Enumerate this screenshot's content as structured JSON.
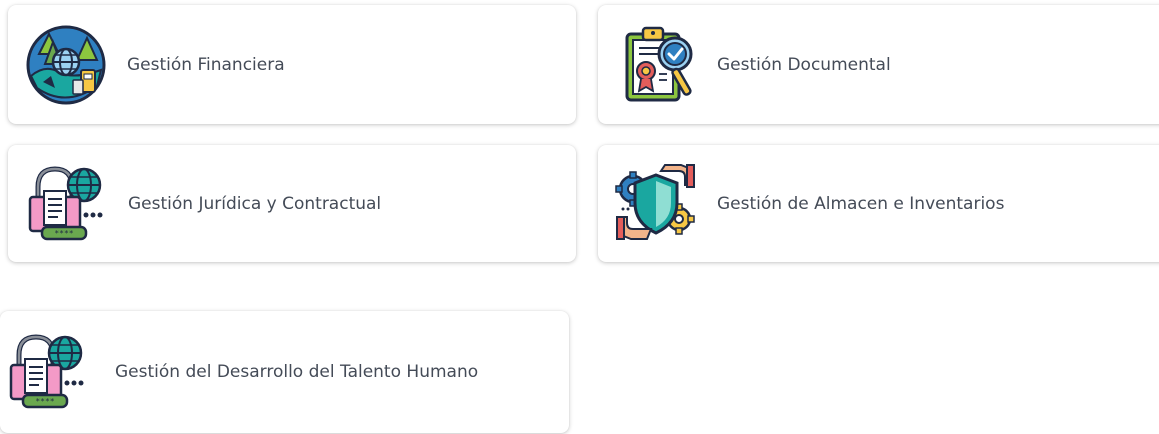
{
  "modules": {
    "financiera": {
      "label": "Gestión Financiera",
      "icon": "earth-finance-icon"
    },
    "documental": {
      "label": "Gestión Documental",
      "icon": "document-certificate-icon"
    },
    "juridica": {
      "label": "Gestión Jurídica y Contractual",
      "icon": "lock-globe-document-icon"
    },
    "almacen": {
      "label": "Gestión de Almacen e Inventarios",
      "icon": "shield-gear-hand-icon"
    },
    "talento": {
      "label": "Gestión del Desarrollo del Talento Humano",
      "icon": "lock-globe-document-icon"
    }
  },
  "colors": {
    "card_background": "#ffffff",
    "label_text": "#444b57",
    "icon_navy": "#1f2a44",
    "icon_teal": "#1aa7a0",
    "icon_green": "#8cc63f",
    "icon_pink": "#f39ac7",
    "icon_blue": "#2f80c1",
    "icon_yellow": "#f7c744"
  }
}
